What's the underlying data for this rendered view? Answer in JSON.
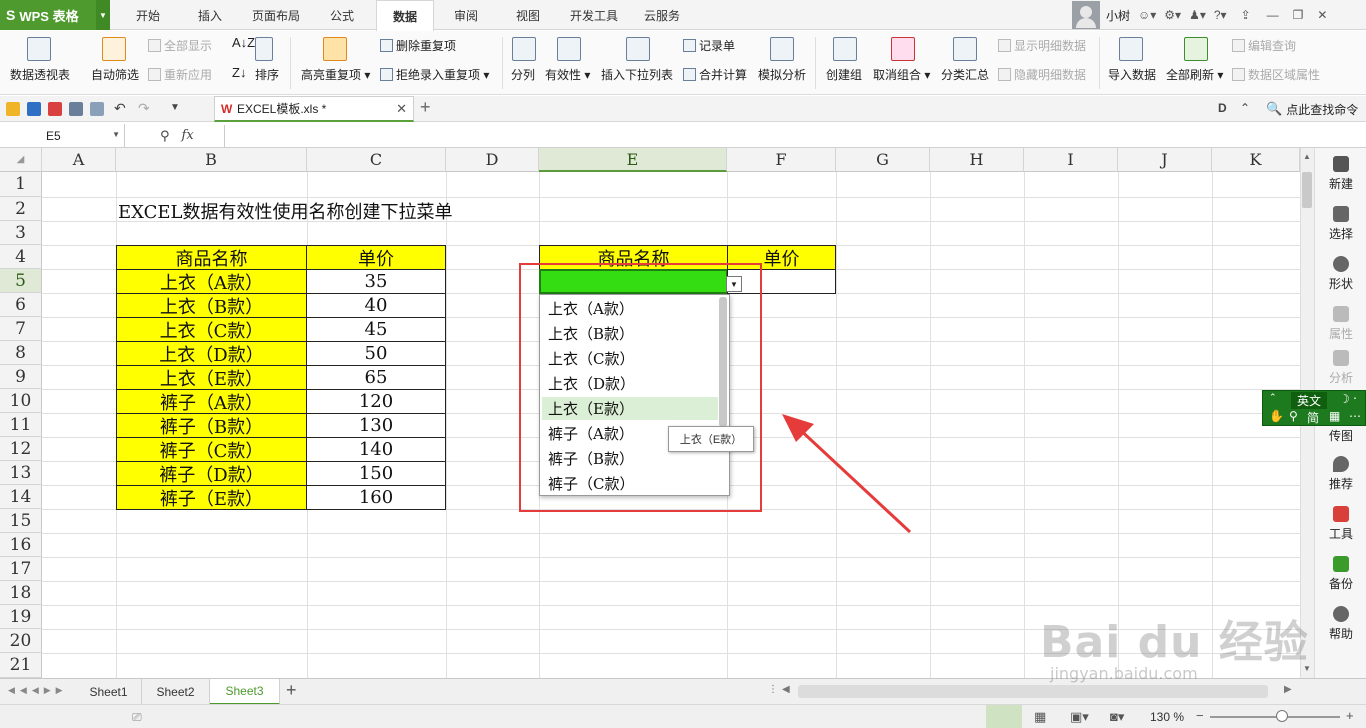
{
  "app": {
    "brand": "WPS 表格"
  },
  "menu_tabs": [
    {
      "label": "开始"
    },
    {
      "label": "插入"
    },
    {
      "label": "页面布局"
    },
    {
      "label": "公式"
    },
    {
      "label": "数据",
      "active": true
    },
    {
      "label": "审阅"
    },
    {
      "label": "视图"
    },
    {
      "label": "开发工具"
    },
    {
      "label": "云服务"
    }
  ],
  "user": {
    "name": "小树"
  },
  "ribbon": {
    "pivot": "数据透视表",
    "autofilter": "自动筛选",
    "show_all": "全部显示",
    "reapply": "重新应用",
    "sort": "排序",
    "highlight_dup": "高亮重复项",
    "delete_dup": "删除重复项",
    "reject_dup": "拒绝录入重复项",
    "split": "分列",
    "validity": "有效性",
    "insert_dropdown": "插入下拉列表",
    "record_form": "记录单",
    "consolidate": "合并计算",
    "simulate": "模拟分析",
    "group": "创建组",
    "ungroup": "取消组合",
    "subtotal": "分类汇总",
    "show_detail": "显示明细数据",
    "hide_detail": "隐藏明细数据",
    "import": "导入数据",
    "refresh_all": "全部刷新",
    "edit_query": "编辑查询",
    "range_props": "数据区域属性"
  },
  "document": {
    "tab_title": "EXCEL模板.xls *"
  },
  "search": {
    "label": "点此查找命令"
  },
  "namebox": {
    "value": "E5"
  },
  "columns": [
    "A",
    "B",
    "C",
    "D",
    "E",
    "F",
    "G",
    "H",
    "I",
    "J",
    "K"
  ],
  "rows": [
    "1",
    "2",
    "3",
    "4",
    "5",
    "6",
    "7",
    "8",
    "9",
    "10",
    "11",
    "12",
    "13",
    "14",
    "15",
    "16",
    "17",
    "18",
    "19",
    "20",
    "21"
  ],
  "sheet": {
    "title": "EXCEL数据有效性使用名称创建下拉菜单",
    "table_header": {
      "name": "商品名称",
      "price": "单价"
    },
    "products": [
      {
        "name": "上衣（A款）",
        "price": "35"
      },
      {
        "name": "上衣（B款）",
        "price": "40"
      },
      {
        "name": "上衣（C款）",
        "price": "45"
      },
      {
        "name": "上衣（D款）",
        "price": "50"
      },
      {
        "name": "上衣（E款）",
        "price": "65"
      },
      {
        "name": "裤子（A款）",
        "price": "120"
      },
      {
        "name": "裤子（B款）",
        "price": "130"
      },
      {
        "name": "裤子（C款）",
        "price": "140"
      },
      {
        "name": "裤子（D款）",
        "price": "150"
      },
      {
        "name": "裤子（E款）",
        "price": "160"
      }
    ],
    "lookup_header": {
      "name": "商品名称",
      "price": "单价"
    }
  },
  "dropdown": {
    "items": [
      "上衣（A款）",
      "上衣（B款）",
      "上衣（C款）",
      "上衣（D款）",
      "上衣（E款）",
      "裤子（A款）",
      "裤子（B款）",
      "裤子（C款）"
    ],
    "highlighted_index": 4,
    "tooltip": "上衣（E款）"
  },
  "sidebar": [
    {
      "label": "新建"
    },
    {
      "label": "选择"
    },
    {
      "label": "形状"
    },
    {
      "label": "属性"
    },
    {
      "label": "分析"
    },
    {
      "label": "传图"
    },
    {
      "label": "推荐"
    },
    {
      "label": "工具"
    },
    {
      "label": "备份"
    },
    {
      "label": "帮助"
    }
  ],
  "ime": {
    "lang": "英文",
    "mode": "简"
  },
  "sheets": [
    {
      "label": "Sheet1"
    },
    {
      "label": "Sheet2"
    },
    {
      "label": "Sheet3",
      "active": true
    }
  ],
  "status": {
    "zoom": "130 %"
  },
  "watermark": {
    "text": "Bai du 经验",
    "url": "jingyan.baidu.com"
  },
  "colors": {
    "accent": "#4e9a2e",
    "highlight_cell": "#33dd11",
    "yellow": "#ffff00",
    "annotation": "#e63b3b"
  }
}
